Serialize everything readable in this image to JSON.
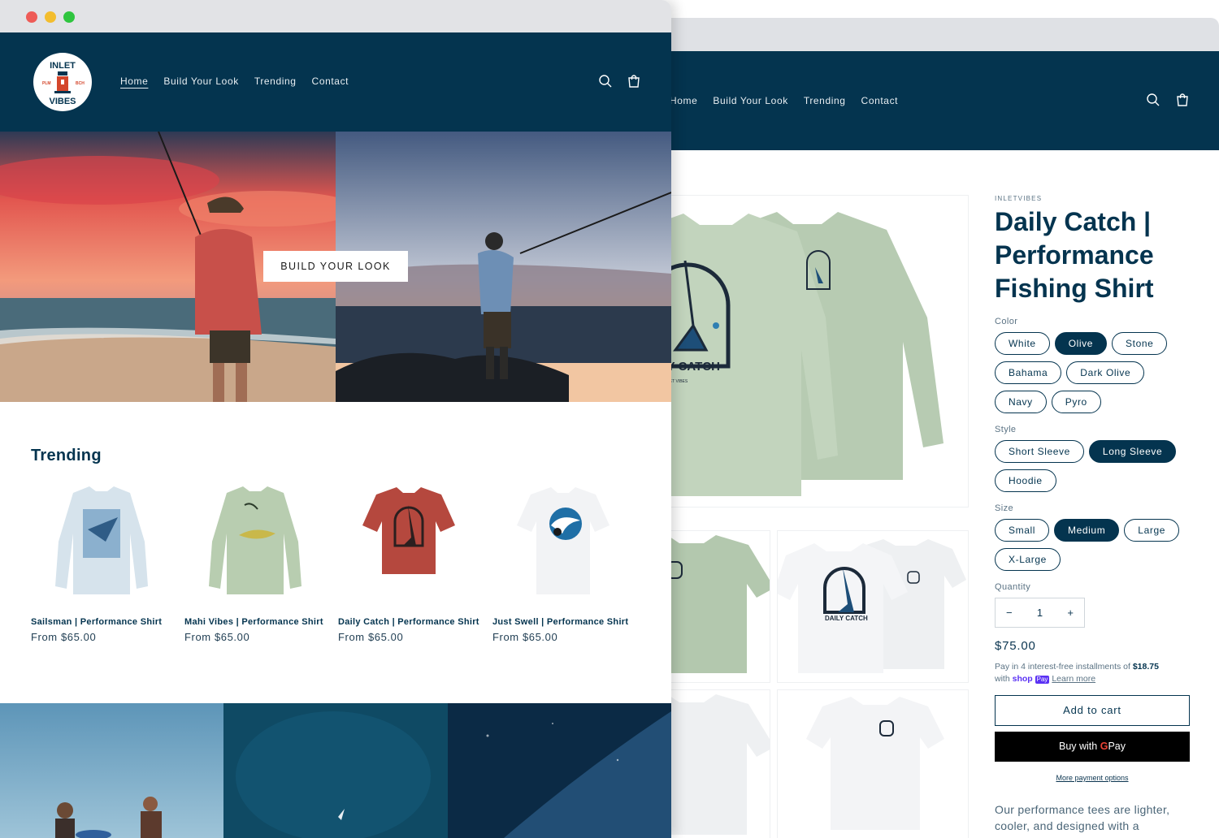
{
  "colors": {
    "brand_navy": "#04344f",
    "accent_red": "#d4462b",
    "shop_pay_purple": "#5a31f4"
  },
  "front": {
    "nav": [
      "Home",
      "Build Your Look",
      "Trending",
      "Contact"
    ],
    "logo": {
      "icon": "inlet-vibes-lighthouse-logo",
      "text_top": "INLET",
      "text_bottom": "VIBES",
      "left": "PLM",
      "right": "BCH"
    },
    "header_icons": [
      "search-icon",
      "cart-icon"
    ],
    "hero_button": "BUILD YOUR LOOK",
    "trending_title": "Trending",
    "products": [
      {
        "name": "Sailsman | Performance Shirt",
        "price": "From $65.00",
        "shirt_color": "#d6e3ec"
      },
      {
        "name": "Mahi Vibes | Performance Shirt",
        "price": "From $65.00",
        "shirt_color": "#b8cdb0"
      },
      {
        "name": "Daily Catch | Performance Shirt",
        "price": "From $65.00",
        "shirt_color": "#b5483e"
      },
      {
        "name": "Just Swell | Performance Shirt",
        "price": "From $65.00",
        "shirt_color": "#f2f3f5"
      }
    ]
  },
  "back": {
    "nav": [
      "Home",
      "Build Your Look",
      "Trending",
      "Contact"
    ],
    "vendor": "INLETVIBES",
    "title": "Daily Catch | Performance Fishing Shirt",
    "main_image_text": "DAILY CATCH",
    "main_image_subtext": "INLET VIBES",
    "thumb_image_text": "DAILY CATCH",
    "color_label": "Color",
    "colors": [
      "White",
      "Olive",
      "Stone",
      "Bahama",
      "Dark Olive",
      "Navy",
      "Pyro"
    ],
    "selected_color": "Olive",
    "style_label": "Style",
    "styles": [
      "Short Sleeve",
      "Long Sleeve",
      "Hoodie"
    ],
    "selected_style": "Long Sleeve",
    "size_label": "Size",
    "sizes": [
      "Small",
      "Medium",
      "Large",
      "X-Large"
    ],
    "selected_size": "Medium",
    "quantity_label": "Quantity",
    "quantity_value": "1",
    "qty_minus": "−",
    "qty_plus": "+",
    "price": "$75.00",
    "installment_prefix": "Pay in 4 interest-free installments of",
    "installment_amount": "$18.75",
    "installment_with": "with",
    "shop_text": "shop",
    "shop_pay_badge": "Pay",
    "learn_more": "Learn more",
    "add_to_cart": "Add to cart",
    "buy_with": "Buy with",
    "gpay_g": "G",
    "gpay_pay": "Pay",
    "more_payment": "More payment options",
    "description": "Our performance tees are lighter, cooler, and designed with a"
  }
}
